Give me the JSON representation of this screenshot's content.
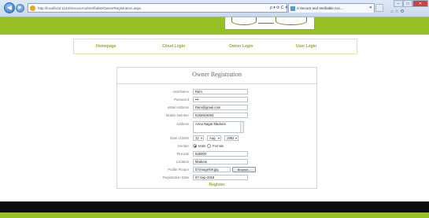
{
  "browser": {
    "url": "http://localhost:1184/SecureAndVerifiable/OwnerRegistration.aspx",
    "tab_title": "A Secure and Verifiable Acc...",
    "tab_close": "✕",
    "address_tools": "ρ ▾ ⟳ C ✕",
    "back_glyph": "◀",
    "forward_glyph": "▶",
    "window_min": "–",
    "window_max": "□",
    "window_close": "✕",
    "right_tools": "⌂ ☆ ⚙"
  },
  "menu": {
    "items": [
      "Homepage",
      "Cloud Login",
      "Owner Login",
      "User Login"
    ]
  },
  "form": {
    "title": "Owner Registration",
    "fields": {
      "username": {
        "label": "UserName",
        "value": "Ram"
      },
      "password": {
        "label": "Password",
        "value": "•••"
      },
      "email": {
        "label": "eMail Address",
        "value": "Ram@gmail.com"
      },
      "mobile": {
        "label": "Mobile Number",
        "value": "9192919293"
      },
      "address": {
        "label": "Address",
        "value": "Anna Nagar Madurai"
      },
      "dob": {
        "label": "Date of Birth",
        "day": "12",
        "month": "Aug",
        "year": "1992"
      },
      "gender": {
        "label": "Gender",
        "option_male": "Male",
        "option_female": "Female",
        "selected": "Male"
      },
      "pincode": {
        "label": "Pincode",
        "value": "625000"
      },
      "location": {
        "label": "Location",
        "value": "Madurai"
      },
      "profile_picture": {
        "label": "Profile Picture",
        "value": "D:\\Image\\08.jpg",
        "browse_label": "Browse..."
      },
      "registration_date": {
        "label": "Registration Date",
        "value": "07-Sep-2019"
      }
    },
    "register_label": "Register",
    "select_arrow": "▾"
  },
  "colors": {
    "brand_green": "#97bf26",
    "menu_text": "#8bb023",
    "footer_black": "#0c0c0c"
  }
}
